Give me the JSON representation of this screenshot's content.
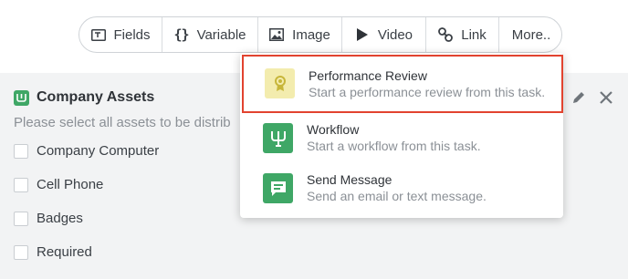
{
  "toolbar": {
    "items": [
      {
        "label": "Fields",
        "icon": "text-field-icon"
      },
      {
        "label": "Variable",
        "icon": "braces-icon"
      },
      {
        "label": "Image",
        "icon": "image-icon"
      },
      {
        "label": "Video",
        "icon": "play-icon"
      },
      {
        "label": "Link",
        "icon": "link-icon"
      },
      {
        "label": "More..",
        "icon": ""
      }
    ]
  },
  "card": {
    "title": "Company Assets",
    "description": "Please select all assets to be distrib",
    "checkboxes": [
      {
        "label": "Company Computer",
        "checked": false
      },
      {
        "label": "Cell Phone",
        "checked": false
      },
      {
        "label": "Badges",
        "checked": false
      },
      {
        "label": "Required",
        "checked": false
      }
    ]
  },
  "menu": {
    "items": [
      {
        "title": "Performance Review",
        "subtitle": "Start a performance review from this task.",
        "icon": "award-ribbon-icon",
        "icon_color": "#f3ecae",
        "highlighted": true
      },
      {
        "title": "Workflow",
        "subtitle": "Start a workflow from this task.",
        "icon": "workflow-icon",
        "icon_color": "#3fa766",
        "highlighted": false
      },
      {
        "title": "Send Message",
        "subtitle": "Send an email or text message.",
        "icon": "message-icon",
        "icon_color": "#3fa766",
        "highlighted": false
      }
    ]
  },
  "colors": {
    "accent_green": "#3fa766",
    "highlight_border": "#e2432f",
    "background_gray": "#f2f3f4"
  }
}
